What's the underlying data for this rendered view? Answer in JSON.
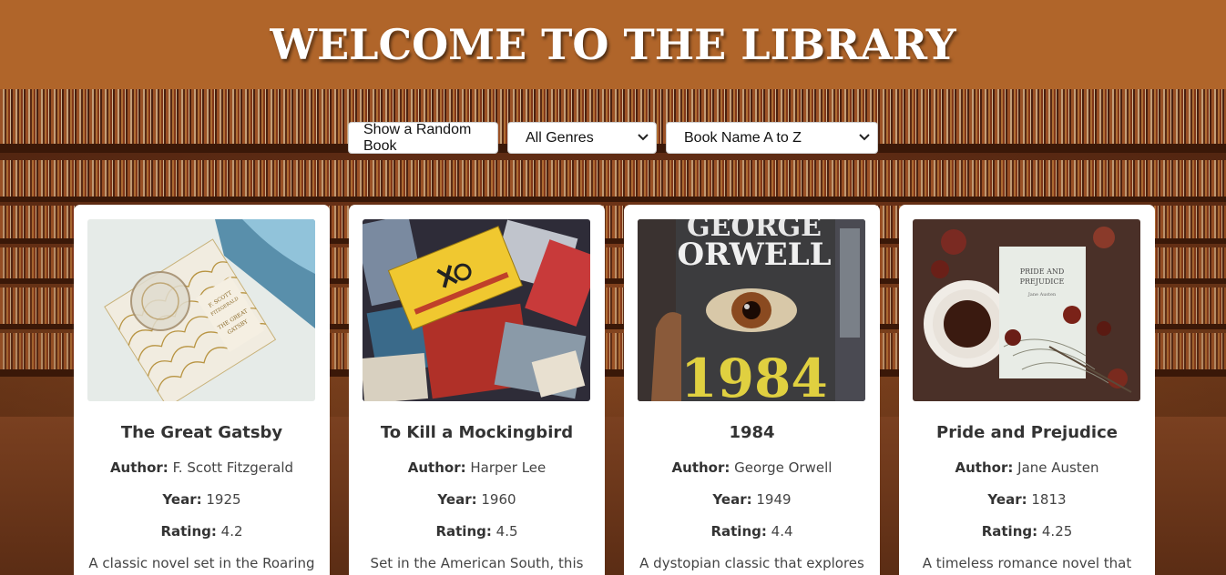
{
  "header": {
    "title": "WELCOME TO THE LIBRARY"
  },
  "controls": {
    "random_label": "Show a Random Book",
    "genre_selected": "All Genres",
    "sort_selected": "Book Name A to Z"
  },
  "labels": {
    "author": "Author:",
    "year": "Year:",
    "rating": "Rating:"
  },
  "books": [
    {
      "title": "The Great Gatsby",
      "author": "F. Scott Fitzgerald",
      "year": "1925",
      "rating": "4.2",
      "description": "A classic novel set in the Roaring",
      "cover_text": [
        "F. SCOTT",
        "FITZGERALD",
        "THE GREAT",
        "GATSBY"
      ]
    },
    {
      "title": "To Kill a Mockingbird",
      "author": "Harper Lee",
      "year": "1960",
      "rating": "4.5",
      "description": "Set in the American South, this",
      "cover_text": []
    },
    {
      "title": "1984",
      "author": "George Orwell",
      "year": "1949",
      "rating": "4.4",
      "description": "A dystopian classic that explores",
      "cover_text": [
        "GEORGE",
        "ORWELL",
        "1984"
      ]
    },
    {
      "title": "Pride and Prejudice",
      "author": "Jane Austen",
      "year": "1813",
      "rating": "4.25",
      "description": "A timeless romance novel that",
      "cover_text": [
        "PRIDE AND",
        "PREJUDICE",
        "Jane Austen"
      ]
    }
  ],
  "colors": {
    "header_bg": "#b0652a",
    "card_bg": "#ffffff",
    "gatsby_bg": "#e8ecea",
    "mockingbird_bg": "#2a2a3a",
    "orwell_bg": "#3a3a3a",
    "austen_bg": "#4a3028"
  },
  "icons": {
    "select_arrow": "chevron-down-icon"
  }
}
